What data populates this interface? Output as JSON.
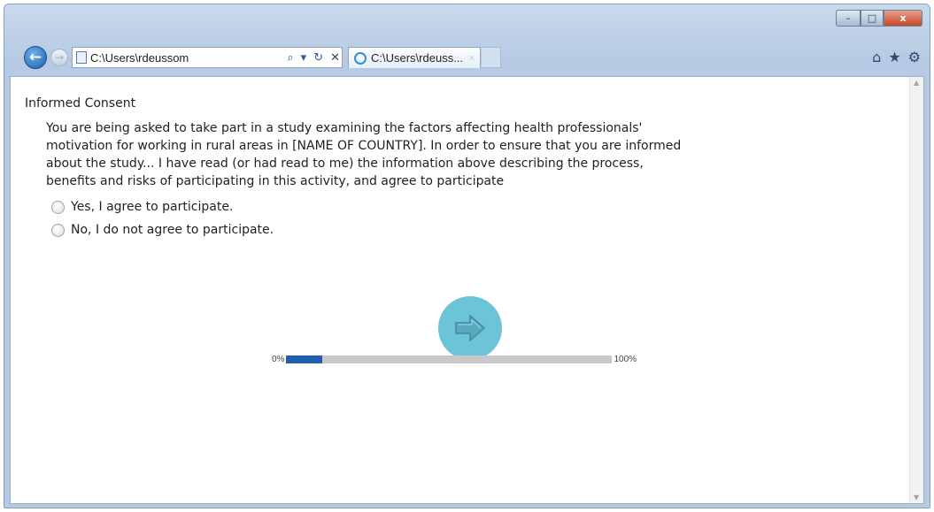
{
  "browser": {
    "address": {
      "url": "C:\\Users\\rdeussom"
    },
    "tab": {
      "title": "C:\\Users\\rdeuss...",
      "close": "×"
    },
    "window_controls": {
      "minimize": "–",
      "maximize": "□",
      "close": "x"
    }
  },
  "survey": {
    "question_title": "Informed Consent",
    "question_lines": [
      "You are being asked to take part in a study examining the factors affecting health professionals'",
      "motivation for working in rural areas in [NAME OF COUNTRY]. In order to ensure that you are informed",
      "about the study... I have read (or had read to me) the information above describing the process,",
      "benefits and risks of participating in this activity, and agree to participate"
    ],
    "options": [
      {
        "label": "Yes, I agree to participate."
      },
      {
        "label": "No, I do not agree to participate."
      }
    ]
  },
  "progress": {
    "start_label": "0%",
    "end_label": "100%",
    "value_percent": 11
  },
  "colors": {
    "next_button": "#6dc3d7",
    "progress_fill": "#1f5fae",
    "progress_track": "#c8c8c8"
  },
  "icons": {
    "back": "back-arrow-icon",
    "forward": "forward-arrow-icon",
    "search": "search-icon",
    "refresh": "refresh-icon",
    "stop": "stop-icon",
    "home": "home-icon",
    "favorites": "star-icon",
    "tools": "gear-icon",
    "next": "arrow-right-icon"
  }
}
